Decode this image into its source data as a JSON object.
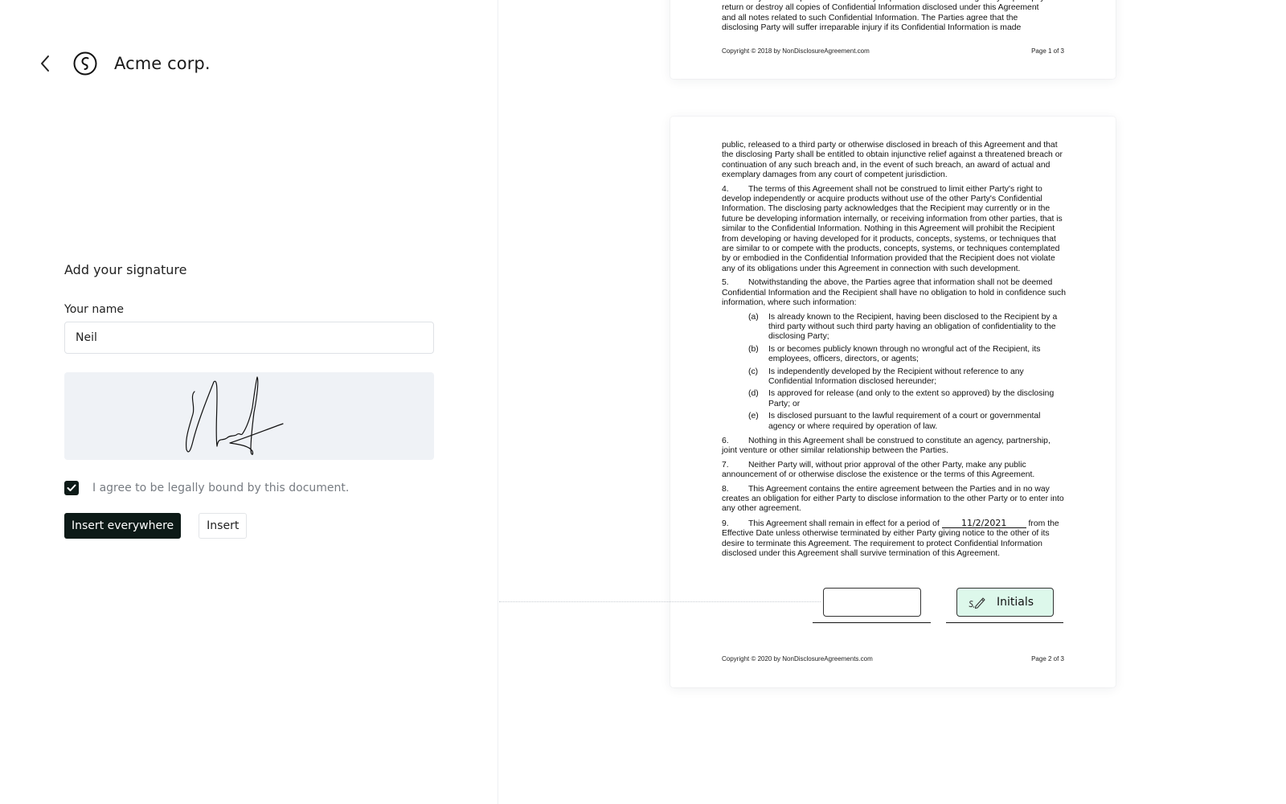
{
  "header": {
    "back_icon": "chevron-left-icon",
    "logo_icon": "circular-s-logo-icon",
    "company": "Acme corp."
  },
  "form": {
    "title": "Add your signature",
    "name_label": "Your name",
    "name_value": "Neil",
    "signature_pad": "Neil (handwritten signature)",
    "agree_checked": true,
    "agree_text": "I agree to be legally bound by this document.",
    "insert_everywhere_label": "Insert everywhere",
    "insert_label": "Insert"
  },
  "document": {
    "page1": {
      "lines": [
        "other Party. The Recipient shall honor any request from the disclosing Party to promptly",
        "return or destroy all copies of Confidential Information disclosed under this Agreement",
        "and all notes related to such Confidential Information. The Parties agree that the",
        "disclosing Party will suffer irreparable injury if its Confidential Information is made"
      ],
      "footer_left": "Copyright © 2018 by NonDisclosureAgreement.com",
      "footer_right": "Page 1 of 3"
    },
    "page2": {
      "intro": "public, released to a third party or otherwise disclosed in breach of this Agreement and that the disclosing Party shall be entitled to obtain injunctive relief against a threatened breach or continuation of any such breach and, in the event of such breach, an award of actual and exemplary damages from any court of competent jurisdiction.",
      "clauses": [
        {
          "num": "4.",
          "text": "The terms of this Agreement shall not be construed to limit either Party's right to develop independently or acquire products without use of the other Party's Confidential Information. The disclosing party acknowledges that the Recipient may currently or in the future be developing information internally, or receiving information from other parties, that is similar to the Confidential Information. Nothing in this Agreement will prohibit the Recipient from developing or having developed for it products, concepts, systems, or techniques that are similar to or compete with the products, concepts, systems, or techniques contemplated by or embodied in the Confidential Information provided that the Recipient does not violate any of its obligations under this Agreement in connection with such development."
        },
        {
          "num": "5.",
          "text": "Notwithstanding the above, the Parties agree that information shall not be deemed Confidential Information and the Recipient shall have no obligation to hold in confidence such information, where such information:"
        }
      ],
      "subclauses": [
        {
          "label": "(a)",
          "text": "Is already known to the Recipient, having been disclosed to the Recipient by a third party without such third party having an obligation of confidentiality to the disclosing Party;"
        },
        {
          "label": "(b)",
          "text": "Is or becomes publicly known through no wrongful act of the Recipient, its employees, officers, directors, or agents;"
        },
        {
          "label": "(c)",
          "text": "Is independently developed by the Recipient without reference to any Confidential Information disclosed hereunder;"
        },
        {
          "label": "(d)",
          "text": "Is approved for release (and only to the extent so approved) by the disclosing Party; or"
        },
        {
          "label": "(e)",
          "text": "Is disclosed pursuant to the lawful requirement of a court or governmental agency or where required by operation of law."
        }
      ],
      "clauses_after": [
        {
          "num": "6.",
          "text": "Nothing in this Agreement shall be construed to constitute an agency, partnership, joint venture or other similar relationship between the Parties."
        },
        {
          "num": "7.",
          "text": "Neither Party will, without prior approval of the other Party, make any public announcement of or otherwise disclose the existence or the terms of this Agreement."
        },
        {
          "num": "8.",
          "text": "This Agreement contains the entire agreement between the Parties and in no way creates an obligation for either Party to disclose information to the other Party or to enter into any other agreement."
        }
      ],
      "clause9": {
        "num": "9.",
        "before": "This Agreement shall remain in effect for a period of",
        "date_value": "11/2/2021",
        "after": "from the Effective Date unless otherwise terminated by either Party giving notice to the other of its desire to terminate this Agreement. The requirement to protect Confidential Information disclosed under this Agreement shall survive termination of this Agreement."
      },
      "signature_field_value": "",
      "initials_field_label": "Initials",
      "initials_icon": "signature-pen-icon",
      "footer_left": "Copyright © 2020 by NonDisclosureAgreements.com",
      "footer_right": "Page 2 of 3"
    }
  },
  "colors": {
    "primary_button": "#0d1a17",
    "signature_pad_bg": "#eff2f6",
    "initials_field_bg": "#ddf8eb"
  }
}
